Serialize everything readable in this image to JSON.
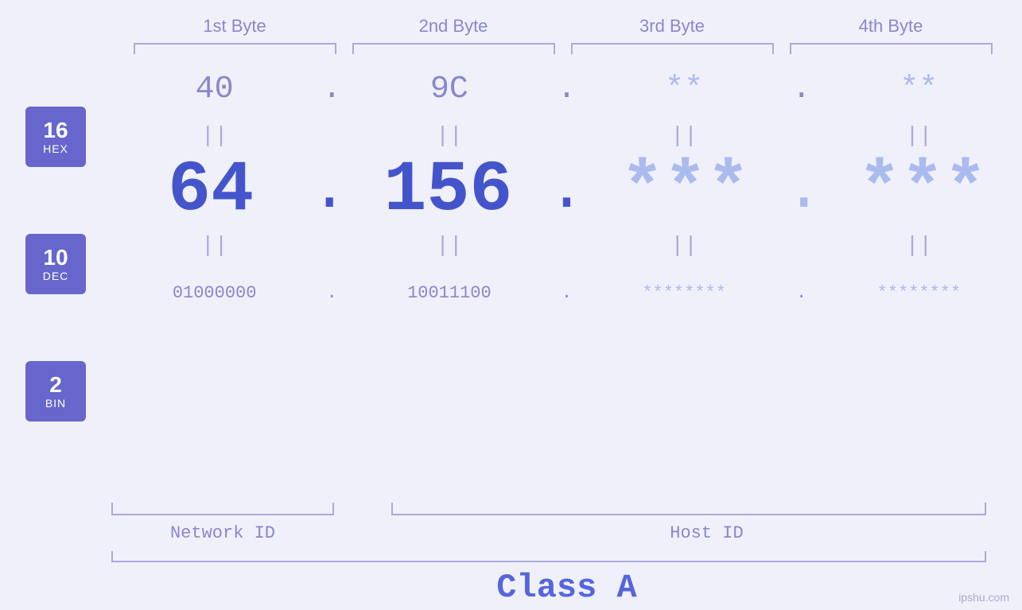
{
  "header": {
    "bytes": [
      "1st Byte",
      "2nd Byte",
      "3rd Byte",
      "4th Byte"
    ]
  },
  "badges": [
    {
      "number": "16",
      "label": "HEX"
    },
    {
      "number": "10",
      "label": "DEC"
    },
    {
      "number": "2",
      "label": "BIN"
    }
  ],
  "hex_row": {
    "values": [
      "40",
      "9C",
      "**",
      "**"
    ],
    "dots": [
      ".",
      ".",
      ".",
      ""
    ]
  },
  "dec_row": {
    "values": [
      "64",
      "156",
      "***",
      "***"
    ],
    "dots": [
      ".",
      ".",
      ".",
      ""
    ]
  },
  "bin_row": {
    "values": [
      "01000000",
      "10011100",
      "********",
      "********"
    ],
    "dots": [
      ".",
      ".",
      ".",
      ""
    ]
  },
  "equals_symbol": "||",
  "network_label": "Network ID",
  "host_label": "Host ID",
  "class_label": "Class A",
  "watermark": "ipshu.com"
}
